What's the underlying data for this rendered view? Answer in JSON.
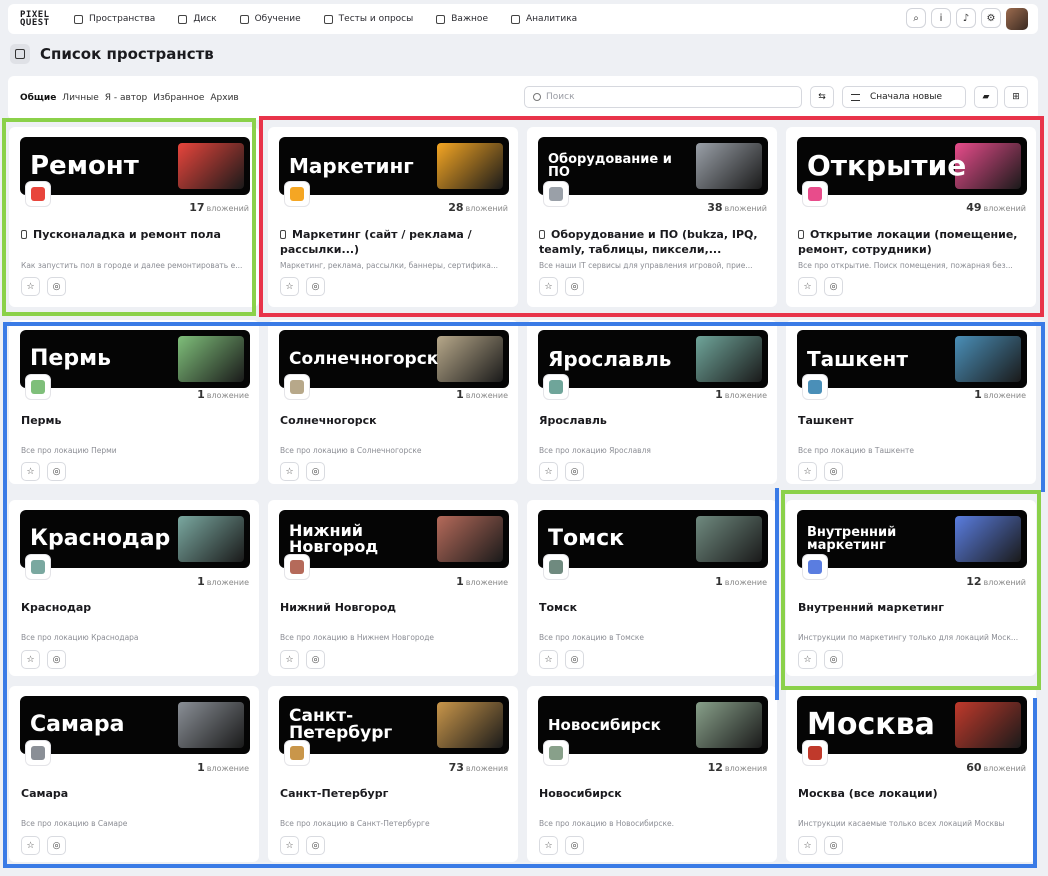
{
  "logo": {
    "line1": "PIXEL",
    "line2": "QUEST"
  },
  "nav": [
    {
      "label": "Пространства"
    },
    {
      "label": "Диск"
    },
    {
      "label": "Обучение"
    },
    {
      "label": "Тесты и опросы"
    },
    {
      "label": "Важное"
    },
    {
      "label": "Аналитика"
    }
  ],
  "header_icons": {
    "search": "⌕",
    "info": "i",
    "bell": "♪",
    "settings": "⚙"
  },
  "page": {
    "title": "Список пространств"
  },
  "tabs": [
    "Общие",
    "Личные",
    "Я - автор",
    "Избранное",
    "Архив"
  ],
  "search": {
    "placeholder": "Поиск"
  },
  "sort": {
    "label": "Сначала новые"
  },
  "toolbar_icons": {
    "swap": "⇆",
    "folder": "▰",
    "grid": "⊞"
  },
  "card_actions": {
    "star": "☆",
    "settings": "◎"
  },
  "cards": [
    {
      "banner": "Ремонт",
      "count": "17",
      "unit": "вложений",
      "title": "Пусконаладка и ремонт пола",
      "desc": "Как запустить пол в городе и далее ремонтировать е...",
      "color": "#e8453c"
    },
    {
      "banner": "Маркетинг",
      "count": "28",
      "unit": "вложений",
      "title": "Маркетинг (сайт / реклама / рассылки...)",
      "desc": "Маркетинг, реклама, рассылки, баннеры, сертифика...",
      "color": "#f5a623"
    },
    {
      "banner": "Оборудование и ПО",
      "count": "38",
      "unit": "вложений",
      "title": "Оборудование и ПО (bukza, IPQ, teamly, таблицы, пиксели,...",
      "desc": "Все наши IT сервисы для управления игровой, прие...",
      "color": "#9aa0a8"
    },
    {
      "banner": "Открытие",
      "count": "49",
      "unit": "вложений",
      "title": "Открытие локации (помещение, ремонт, сотрудники)",
      "desc": "Все про открытие. Поиск помещения, пожарная без...",
      "color": "#e84c8b"
    },
    {
      "banner": "Пермь",
      "count": "1",
      "unit": "вложение",
      "title": "Пермь",
      "desc": "Все про локацию Перми",
      "color": "#7fbf7a"
    },
    {
      "banner": "Солнечногорск",
      "count": "1",
      "unit": "вложение",
      "title": "Солнечногорск",
      "desc": "Все про локацию в Солнечногорске",
      "color": "#b7a88a"
    },
    {
      "banner": "Ярославль",
      "count": "1",
      "unit": "вложение",
      "title": "Ярославль",
      "desc": "Все про локацию Ярославля",
      "color": "#6fa59a"
    },
    {
      "banner": "Ташкент",
      "count": "1",
      "unit": "вложение",
      "title": "Ташкент",
      "desc": "Все про локацию в Ташкенте",
      "color": "#4a8fb8"
    },
    {
      "banner": "Краснодар",
      "count": "1",
      "unit": "вложение",
      "title": "Краснодар",
      "desc": "Все про локацию Краснодара",
      "color": "#7aa8a0"
    },
    {
      "banner": "Нижний Новгород",
      "count": "1",
      "unit": "вложение",
      "title": "Нижний Новгород",
      "desc": "Все про локацию в Нижнем Новгороде",
      "color": "#b56a5a"
    },
    {
      "banner": "Томск",
      "count": "1",
      "unit": "вложение",
      "title": "Томск",
      "desc": "Все про локацию в Томске",
      "color": "#6f8a7f"
    },
    {
      "banner": "Внутренний маркетинг",
      "count": "12",
      "unit": "вложений",
      "title": "Внутренний маркетинг",
      "desc": "Инструкции по маркетингу только для локаций Моск...",
      "color": "#5a7de0"
    },
    {
      "banner": "Самара",
      "count": "1",
      "unit": "вложение",
      "title": "Самара",
      "desc": "Все про локацию в Самаре",
      "color": "#8a8f96"
    },
    {
      "banner": "Санкт-Петербург",
      "count": "73",
      "unit": "вложения",
      "title": "Санкт-Петербург",
      "desc": "Все про локацию в Санкт-Петербурге",
      "color": "#c9964a"
    },
    {
      "banner": "Новосибирск",
      "count": "12",
      "unit": "вложения",
      "title": "Новосибирск",
      "desc": "Все про локацию в Новосибирске.",
      "color": "#88a08a"
    },
    {
      "banner": "Москва",
      "count": "60",
      "unit": "вложений",
      "title": "Москва (все локации)",
      "desc": "Инструкции касаемые только всех локаций Москвы",
      "color": "#c0392b"
    }
  ],
  "frame_colors": {
    "green": "#8bd14a",
    "red": "#e8344a",
    "blue": "#3a7be6"
  }
}
